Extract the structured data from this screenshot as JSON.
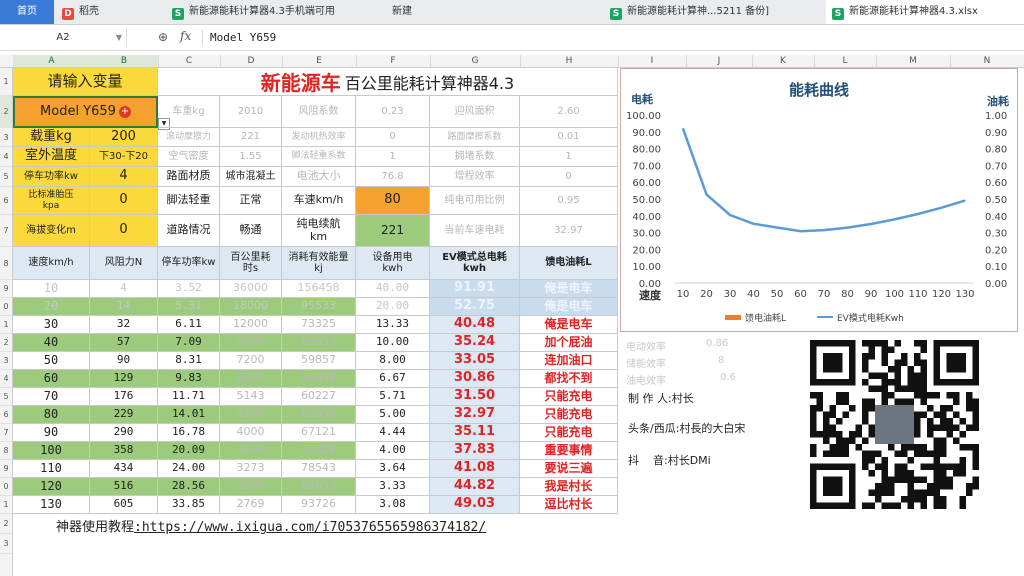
{
  "tabs": [
    {
      "label": "首页",
      "icon": ""
    },
    {
      "label": "稻壳",
      "icon": "docer-icon"
    },
    {
      "label": "新能源能耗计算器4.3手机端可用",
      "icon": "spreadsheet-icon"
    },
    {
      "label": "新建",
      "icon": ""
    },
    {
      "label": "新能源能耗计算神...5211 备份]",
      "icon": "spreadsheet-icon"
    },
    {
      "label": "新能源能耗计算神器4.3.xlsx",
      "icon": "spreadsheet-icon"
    }
  ],
  "formula_bar": {
    "cell_ref": "A2",
    "fx": "fx",
    "formula": "Model Y659"
  },
  "columns": [
    "A",
    "B",
    "C",
    "D",
    "E",
    "F",
    "G",
    "H",
    "I",
    "J",
    "K",
    "L",
    "M",
    "N"
  ],
  "rows": [
    "1",
    "2",
    "3",
    "4",
    "5",
    "6",
    "7",
    "8",
    "9",
    "0",
    "1",
    "2",
    "3",
    "4",
    "5",
    "6",
    "7",
    "8",
    "9",
    "0",
    "1",
    "2",
    "3"
  ],
  "sheet": {
    "input_label": "请输入变量",
    "title_red": "新能源车",
    "title_rest": "百公里能耗计算神器4.3",
    "model": "Model Y659",
    "load_label": "载重kg",
    "load_value": "200",
    "temp_label": "室外温度",
    "temp_value": "下30-下20",
    "stop_power_label": "停车功率kw",
    "stop_power_value": "4",
    "tire_label": "比标准胎压kpa",
    "tire_value": "0",
    "altitude_label": "海拔变化m",
    "altitude_value": "0",
    "road_material_label": "路面材质",
    "road_material_value": "城市混凝土",
    "pedal_label": "脚法轻重",
    "pedal_value": "正常",
    "road_status_label": "道路情况",
    "road_status_value": "畅通",
    "speed_label": "车速km/h",
    "speed_value": "80",
    "range_label": "纯电续航km",
    "range_value": "221",
    "params": [
      [
        "车重kg",
        "2010",
        "风阻系数",
        "0.23",
        "迎风面积",
        "2.60"
      ],
      [
        "滚动摩擦力",
        "221",
        "发动机热效率",
        "0",
        "路面摩擦系数",
        "0.01"
      ],
      [
        "空气密度",
        "1.55",
        "脚法轻重系数",
        "1",
        "拥堵系数",
        "1"
      ],
      [
        "电池大小",
        "76.8",
        "增程效率",
        "0"
      ],
      [
        "纯电可用比例",
        "0.95"
      ],
      [
        "当前车速电耗",
        "32.97"
      ]
    ],
    "table_headers": [
      "速度km/h",
      "风阻力N",
      "停车功率kw",
      "百公里耗时s",
      "消耗有效能量kj",
      "设备用电kwh",
      "EV模式总电耗kwh",
      "馈电油耗L"
    ],
    "table_rows": [
      [
        "10",
        "4",
        "3.52",
        "36000",
        "156458",
        "40.00",
        "91.91",
        "俺是电车"
      ],
      [
        "20",
        "14",
        "5.31",
        "18000",
        "95533",
        "20.00",
        "52.75",
        "俺是电车"
      ],
      [
        "30",
        "32",
        "6.11",
        "12000",
        "73325",
        "13.33",
        "40.48",
        "俺是电车"
      ],
      [
        "40",
        "57",
        "7.09",
        "9000",
        "63833",
        "10.00",
        "35.24",
        "加个屁油"
      ],
      [
        "50",
        "90",
        "8.31",
        "7200",
        "59857",
        "8.00",
        "33.05",
        "连加油口"
      ],
      [
        "60",
        "129",
        "9.83",
        "6000",
        "58998",
        "6.67",
        "30.86",
        "都找不到"
      ],
      [
        "70",
        "176",
        "11.71",
        "5143",
        "60227",
        "5.71",
        "31.50",
        "只能充电"
      ],
      [
        "80",
        "229",
        "14.01",
        "4500",
        "63030",
        "5.00",
        "32.97",
        "只能充电"
      ],
      [
        "90",
        "290",
        "16.78",
        "4000",
        "67121",
        "4.44",
        "35.11",
        "只能充电"
      ],
      [
        "100",
        "358",
        "20.09",
        "3600",
        "72328",
        "4.00",
        "37.83",
        "重要事情"
      ],
      [
        "110",
        "434",
        "24.00",
        "3273",
        "78543",
        "3.64",
        "41.08",
        "要说三遍"
      ],
      [
        "120",
        "516",
        "28.56",
        "3000",
        "85693",
        "3.33",
        "44.82",
        "我是村长"
      ],
      [
        "130",
        "605",
        "33.85",
        "2769",
        "93726",
        "3.08",
        "49.03",
        "逗比村长"
      ]
    ],
    "tutorial_label": "神器使用教程",
    "tutorial_url": ":https://www.ixigua.com/i7053765565986374182/",
    "side_notes": [
      {
        "label": "电动效率",
        "value": "0.86"
      },
      {
        "label": "储能效率",
        "value": "8"
      },
      {
        "label": "油电效率",
        "value": "0.6"
      }
    ]
  },
  "credits": {
    "maker_label": "制 作 人:",
    "maker_value": "村长",
    "toutiao_label": "头条/西瓜:",
    "toutiao_value": "村長的大白宋",
    "douyin_label": "抖    音:",
    "douyin_value": "村长DMi"
  },
  "chart_data": {
    "type": "line",
    "title": "能耗曲线",
    "y_left_label": "电耗",
    "y_right_label": "油耗",
    "x_label": "速度",
    "x": [
      10,
      20,
      30,
      40,
      50,
      60,
      70,
      80,
      90,
      100,
      110,
      120,
      130
    ],
    "y_left_ticks": [
      "100.00",
      "90.00",
      "80.00",
      "70.00",
      "60.00",
      "50.00",
      "40.00",
      "30.00",
      "20.00",
      "10.00",
      "0.00"
    ],
    "y_right_ticks": [
      "1.00",
      "0.90",
      "0.80",
      "0.70",
      "0.60",
      "0.50",
      "0.40",
      "0.30",
      "0.20",
      "0.10",
      "0.00"
    ],
    "ylim_left": [
      0,
      100
    ],
    "ylim_right": [
      0,
      1
    ],
    "series": [
      {
        "name": "馈电油耗L",
        "axis": "right",
        "color": "#ed7d31",
        "values": []
      },
      {
        "name": "EV模式电耗Kwh",
        "axis": "left",
        "color": "#5b9bd5",
        "values": [
          91.91,
          52.75,
          40.48,
          35.24,
          33.05,
          30.86,
          31.5,
          32.97,
          35.11,
          37.83,
          41.08,
          44.82,
          49.03
        ]
      }
    ],
    "legend_position": "bottom",
    "grid": false
  },
  "colors": {
    "yellow": "#fbd93b",
    "orange": "#f5a12d",
    "green": "#9ccb7b",
    "red": "#e02323",
    "header_blue": "#dde8f3"
  }
}
